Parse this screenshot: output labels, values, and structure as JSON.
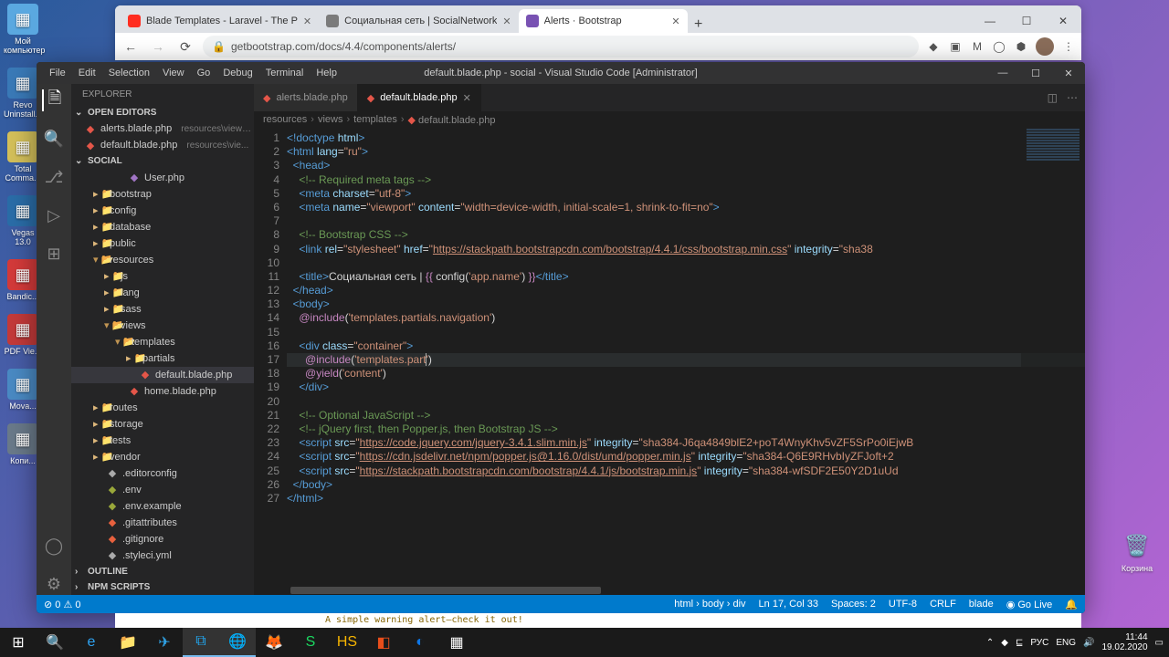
{
  "desktop": {
    "icons": [
      "Мой компьютер",
      "Revo Uninstall...",
      "Total Comma...",
      "Vegas 13.0",
      "Bandic...",
      "PDF Vie...",
      "Mova...",
      "Копи..."
    ],
    "trash": "Корзина"
  },
  "browser": {
    "tabs": [
      {
        "title": "Blade Templates - Laravel - The P",
        "favColor": "#ff2d20"
      },
      {
        "title": "Социальная сеть | SocialNetwork",
        "favColor": "#7b7b7b"
      },
      {
        "title": "Alerts · Bootstrap",
        "favColor": "#7952b3"
      }
    ],
    "url": "getbootstrap.com/docs/4.4/components/alerts/",
    "winctrl": {
      "min": "—",
      "max": "☐",
      "close": "✕"
    }
  },
  "vscode": {
    "menu": [
      "File",
      "Edit",
      "Selection",
      "View",
      "Go",
      "Debug",
      "Terminal",
      "Help"
    ],
    "title": "default.blade.php - social - Visual Studio Code [Administrator]",
    "explorer": {
      "title": "EXPLORER",
      "openEditors": "OPEN EDITORS",
      "openFiles": [
        {
          "name": "alerts.blade.php",
          "path": "resources\\views..."
        },
        {
          "name": "default.blade.php",
          "path": "resources\\vie..."
        }
      ],
      "workspace": "SOCIAL",
      "tree": [
        {
          "d": 3,
          "t": "file",
          "icon": "phpf",
          "name": "User.php"
        },
        {
          "d": 1,
          "t": "folder",
          "name": "bootstrap"
        },
        {
          "d": 1,
          "t": "folder",
          "name": "config"
        },
        {
          "d": 1,
          "t": "folder",
          "name": "database"
        },
        {
          "d": 1,
          "t": "folder",
          "name": "public"
        },
        {
          "d": 1,
          "t": "folder-open",
          "name": "resources"
        },
        {
          "d": 2,
          "t": "folder",
          "name": "js"
        },
        {
          "d": 2,
          "t": "folder",
          "name": "lang"
        },
        {
          "d": 2,
          "t": "folder",
          "name": "sass"
        },
        {
          "d": 2,
          "t": "folder-open",
          "name": "views"
        },
        {
          "d": 3,
          "t": "folder-open",
          "name": "templates"
        },
        {
          "d": 4,
          "t": "folder",
          "name": "partials"
        },
        {
          "d": 4,
          "t": "file",
          "icon": "bladef",
          "name": "default.blade.php",
          "selected": true
        },
        {
          "d": 3,
          "t": "file",
          "icon": "bladef",
          "name": "home.blade.php"
        },
        {
          "d": 1,
          "t": "folder",
          "name": "routes"
        },
        {
          "d": 1,
          "t": "folder",
          "name": "storage"
        },
        {
          "d": 1,
          "t": "folder",
          "name": "tests"
        },
        {
          "d": 1,
          "t": "folder",
          "name": "vendor"
        },
        {
          "d": 1,
          "t": "file",
          "icon": "genf",
          "name": ".editorconfig"
        },
        {
          "d": 1,
          "t": "file",
          "icon": "envf",
          "name": ".env"
        },
        {
          "d": 1,
          "t": "file",
          "icon": "envf",
          "name": ".env.example"
        },
        {
          "d": 1,
          "t": "file",
          "icon": "gitf",
          "name": ".gitattributes"
        },
        {
          "d": 1,
          "t": "file",
          "icon": "gitf",
          "name": ".gitignore"
        },
        {
          "d": 1,
          "t": "file",
          "icon": "genf",
          "name": ".styleci.yml"
        }
      ],
      "outline": "OUTLINE",
      "npm": "NPM SCRIPTS"
    },
    "editorTabs": [
      {
        "name": "alerts.blade.php",
        "active": false
      },
      {
        "name": "default.blade.php",
        "active": true
      }
    ],
    "breadcrumb": [
      "resources",
      "views",
      "templates",
      "default.blade.php"
    ],
    "status": {
      "left": [
        "⊘ 0 ⚠ 0"
      ],
      "right": [
        "html › body › div",
        "Ln 17, Col 33",
        "Spaces: 2",
        "UTF-8",
        "CRLF",
        "blade",
        "◉ Go Live",
        "🔔"
      ]
    }
  },
  "peek": "A simple warning alert—check it out!",
  "tray": {
    "lang": "РУС",
    "kbd": "ENG",
    "time": "11:44",
    "date": "19.02.2020"
  }
}
